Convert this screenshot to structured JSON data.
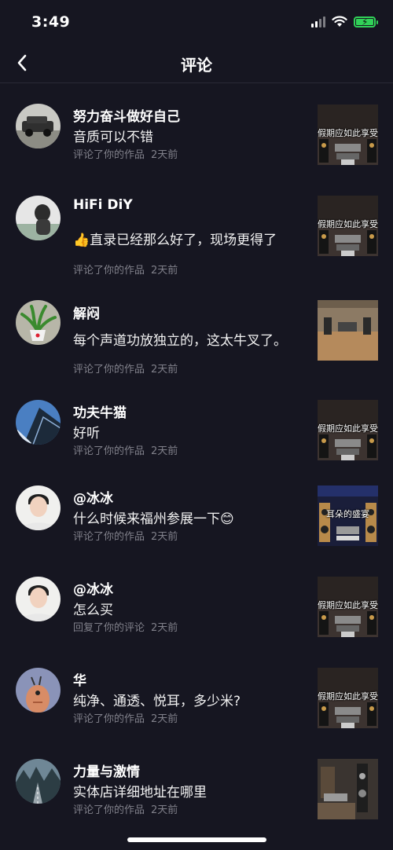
{
  "status_bar": {
    "time": "3:49"
  },
  "nav": {
    "title": "评论"
  },
  "comments": [
    {
      "name": "努力奋斗做好自己",
      "text": "音质可以不错",
      "action": "评论了你的作品",
      "time": "2天前",
      "thumb_caption": "假期应如此享受",
      "avatar_icon": "car-avatar",
      "thumb_icon": "hifi-room-thumb"
    },
    {
      "name": "HiFi DiY",
      "text": "直录已经那么好了，现场更得了",
      "emoji_prefix": "👍",
      "action": "评论了你的作品",
      "time": "2天前",
      "thumb_caption": "假期应如此享受",
      "avatar_icon": "person-avatar",
      "thumb_icon": "hifi-room-thumb"
    },
    {
      "name": "解闷",
      "text": "每个声道功放独立的，这太牛叉了。",
      "action": "评论了你的作品",
      "time": "2天前",
      "thumb_caption": "",
      "avatar_icon": "plant-avatar",
      "thumb_icon": "wood-room-thumb"
    },
    {
      "name": "功夫牛猫",
      "text": "好听",
      "action": "评论了你的作品",
      "time": "2天前",
      "thumb_caption": "假期应如此享受",
      "avatar_icon": "building-avatar",
      "thumb_icon": "hifi-room-thumb"
    },
    {
      "name": "@冰冰",
      "text": "什么时候来福州参展一下",
      "emoji_suffix": "😊",
      "action": "评论了你的作品",
      "time": "2天前",
      "thumb_caption": "耳朵的盛宴",
      "avatar_icon": "man-avatar",
      "thumb_icon": "speaker-thumb"
    },
    {
      "name": "@冰冰",
      "text": "怎么买",
      "action": "回复了你的评论",
      "time": "2天前",
      "thumb_caption": "假期应如此享受",
      "avatar_icon": "man-avatar",
      "thumb_icon": "hifi-room-thumb"
    },
    {
      "name": "华",
      "text": "纯净、通透、悦耳，多少米?",
      "action": "评论了你的作品",
      "time": "2天前",
      "thumb_caption": "假期应如此享受",
      "avatar_icon": "cartoon-avatar",
      "thumb_icon": "hifi-room-thumb"
    },
    {
      "name": "力量与激情",
      "text": "实体店详细地址在哪里",
      "action": "评论了你的作品",
      "time": "2天前",
      "thumb_caption": "",
      "avatar_icon": "road-avatar",
      "thumb_icon": "workshop-thumb"
    }
  ],
  "colors": {
    "background": "#161621",
    "meta_text": "#80808a",
    "battery": "#31d158"
  }
}
